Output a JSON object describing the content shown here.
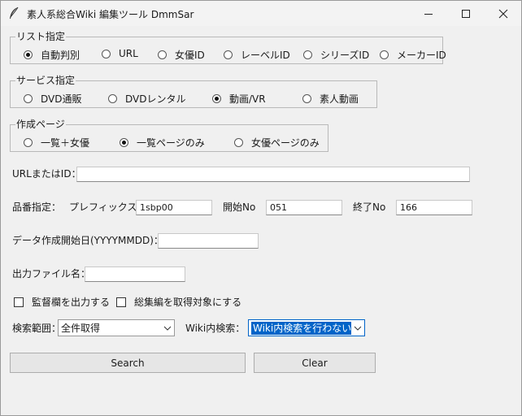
{
  "titlebar": {
    "title": "素人系総合Wiki 編集ツール DmmSar",
    "icon": "feather-pen-icon"
  },
  "list_type": {
    "legend": "リスト指定",
    "options": [
      "自動判別",
      "URL",
      "女優ID",
      "レーベルID",
      "シリーズID",
      "メーカーID"
    ],
    "selected": "自動判別"
  },
  "service": {
    "legend": "サービス指定",
    "options": [
      "DVD通販",
      "DVDレンタル",
      "動画/VR",
      "素人動画"
    ],
    "selected": "動画/VR"
  },
  "page_type": {
    "legend": "作成ページ",
    "options": [
      "一覧＋女優",
      "一覧ページのみ",
      "女優ページのみ"
    ],
    "selected": "一覧ページのみ"
  },
  "url_field": {
    "label": "URLまたはID：",
    "value": ""
  },
  "product": {
    "label": "品番指定：",
    "prefix_label": "プレフィックス",
    "prefix_value": "1sbp00",
    "start_label": "開始No",
    "start_value": "051",
    "end_label": "終了No",
    "end_value": "166"
  },
  "date_field": {
    "label": "データ作成開始日(YYYYMMDD)：",
    "value": ""
  },
  "output_field": {
    "label": "出力ファイル名：",
    "value": ""
  },
  "checkboxes": [
    {
      "label": "監督欄を出力する",
      "checked": false
    },
    {
      "label": "総集編を取得対象にする",
      "checked": false
    }
  ],
  "search_range": {
    "label": "検索範囲：",
    "selected": "全件取得"
  },
  "wiki_search": {
    "label": "Wiki内検索：",
    "selected": "Wiki内検索を行わない"
  },
  "buttons": {
    "search": "Search",
    "clear": "Clear"
  }
}
